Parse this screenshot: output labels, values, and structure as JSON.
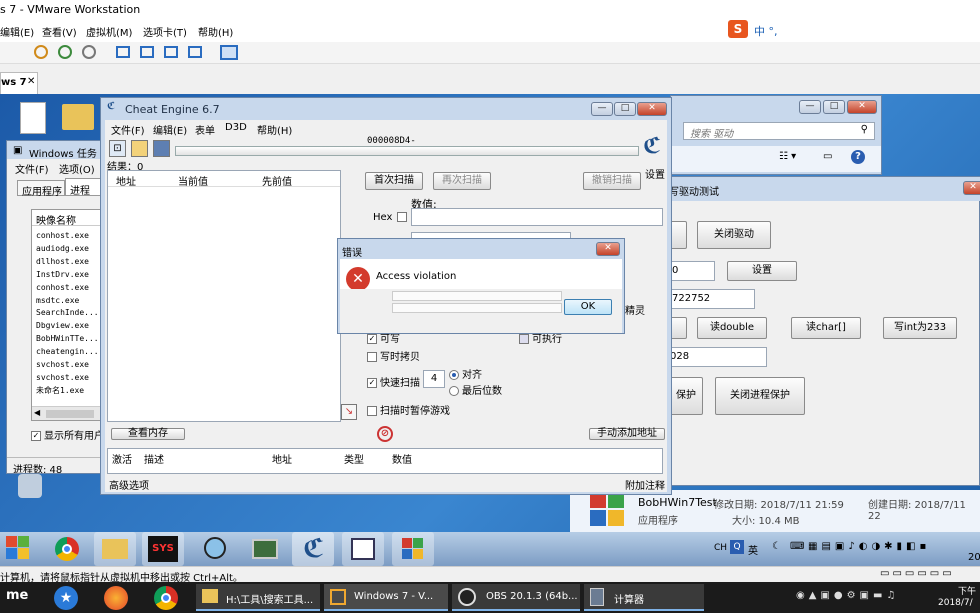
{
  "vmware": {
    "title": "s 7 - VMware Workstation",
    "menu": [
      "编辑(E)",
      "查看(V)",
      "虚拟机(M)",
      "选项卡(T)",
      "帮助(H)"
    ],
    "tab_label": "ws 7",
    "ime_label": "中 °,",
    "status_hint": "计算机，请将鼠标指针从虚拟机中移出或按 Ctrl+Alt。"
  },
  "explorer": {
    "search_placeholder": "搜索 驱动"
  },
  "taskmgr": {
    "title": "Windows 任务管",
    "menu": [
      "文件(F)",
      "选项(O)"
    ],
    "tabs": [
      "应用程序",
      "进程"
    ],
    "column": "映像名称",
    "processes": [
      "conhost.exe",
      "audiodg.exe",
      "dllhost.exe",
      "InstDrv.exe",
      "conhost.exe",
      "msdtc.exe",
      "SearchInde...",
      "Dbgview.exe",
      "BobHWinTTe...",
      "cheatengin...",
      "svchost.exe",
      "svchost.exe",
      "未命名1.exe"
    ],
    "show_all_label": "显示所有用户",
    "process_count": "进程数: 48"
  },
  "driver_window": {
    "title": "写驱动测试",
    "close_driver": "关闭驱动",
    "settings": "设置",
    "value_field": "722752",
    "read_double": "读double",
    "read_char": "读char[]",
    "write_int": "写int为233",
    "field2": "028",
    "protect_partial": "保护",
    "close_protect": "关闭进程保护",
    "partial_field": "0"
  },
  "cheat_engine": {
    "title": "Cheat Engine 6.7",
    "menu": [
      "文件(F)",
      "编辑(E)",
      "表单",
      "D3D",
      "帮助(H)"
    ],
    "process_label": "000008D4-",
    "settings_label": "设置",
    "results_label": "结果：0",
    "list_headers": [
      "地址",
      "当前值",
      "先前值"
    ],
    "first_scan": "首次扫描",
    "next_scan": "再次扫描",
    "undo_scan": "撤销扫描",
    "value_label": "数值:",
    "hex_label": "Hex",
    "options_partial": "精灵",
    "writable": "可写",
    "executable": "可执行",
    "copy_on_write": "写时拷贝",
    "fast_scan": "快速扫描",
    "fast_scan_value": "4",
    "align": "对齐",
    "last_digits": "最后位数",
    "pause_game": "扫描时暂停游戏",
    "view_memory": "查看内存",
    "add_manual": "手动添加地址",
    "table_headers": [
      "激活",
      "描述",
      "地址",
      "类型",
      "数值"
    ],
    "advanced": "高级选项",
    "annotations": "附加注释"
  },
  "error_dialog": {
    "title": "错误",
    "message": "Access violation",
    "ok": "OK"
  },
  "file_info": {
    "name": "BobHWin7Test",
    "type": "应用程序",
    "modified": "修改日期: 2018/7/11 21:59",
    "created": "创建日期: 2018/7/11 22",
    "size": "大小: 10.4 MB"
  },
  "guest_tray": {
    "lang": "CH",
    "ime": "英",
    "time_partial": "20"
  },
  "host_taskbar": {
    "app_icon": "me",
    "items": [
      "H:\\工具\\搜索工具...",
      "Windows 7 - V...",
      "OBS 20.1.3 (64b...",
      "计算器"
    ],
    "time_top": "下午",
    "date": "2018/7/"
  },
  "colors": {
    "desktop": "#2b6cb0",
    "window_frame": "#c8d8ec",
    "title_text": "#1f2f45",
    "close_red": "#c4432a"
  }
}
